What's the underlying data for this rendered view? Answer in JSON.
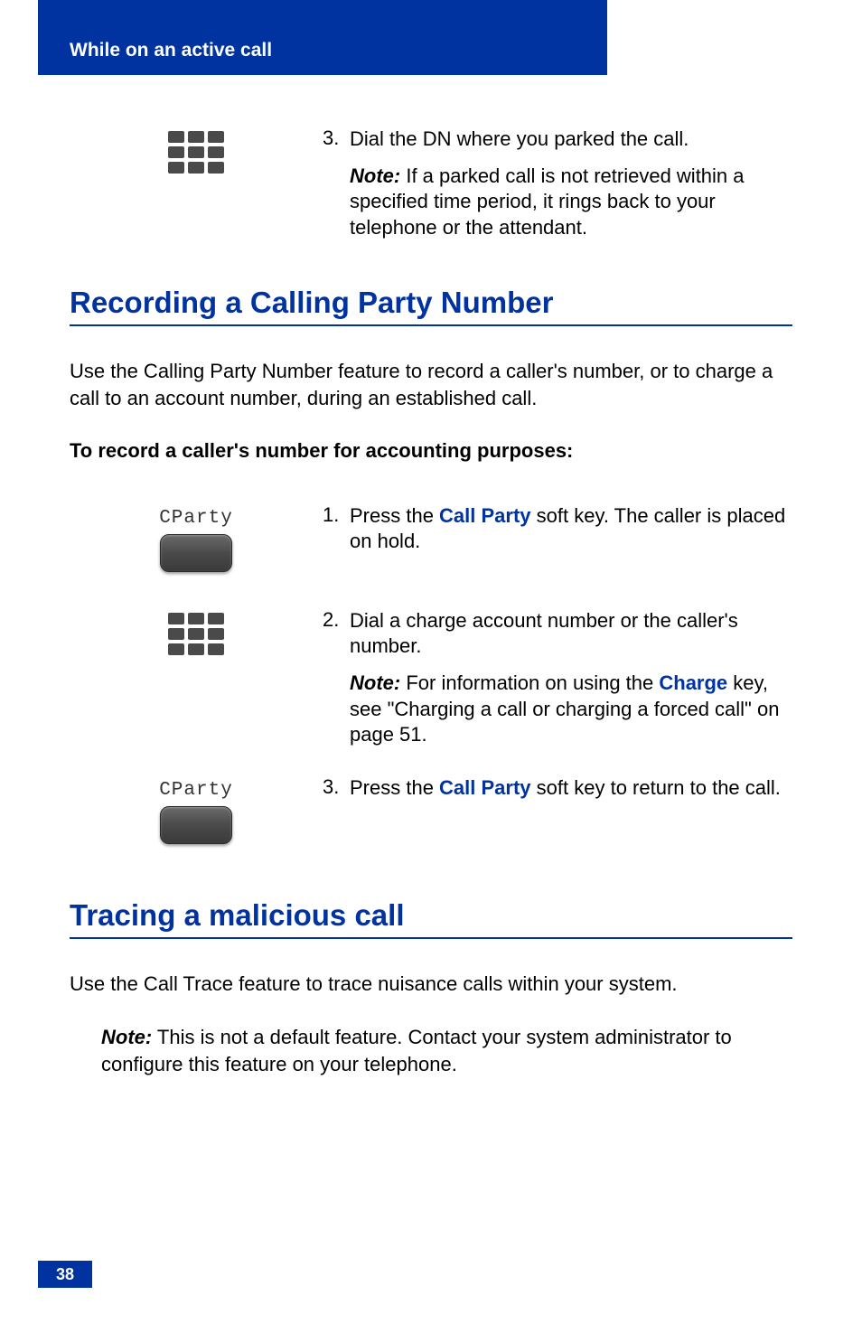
{
  "header": {
    "section_title": "While on an active call"
  },
  "step_dial_parked": {
    "number": "3.",
    "text": "Dial the DN where you parked the call.",
    "note_label": "Note:",
    "note_text": " If a parked call is not retrieved within a specified time period, it rings back to your telephone or the attendant."
  },
  "heading_recording": "Recording a Calling Party Number",
  "recording_intro": "Use the Calling Party Number feature to record a caller's number, or to charge a call to an account number, during an established call.",
  "recording_procedure_title": "To record a caller's number for accounting purposes:",
  "softkey_cparty": "CParty",
  "recording_steps": {
    "step1": {
      "number": "1.",
      "text_before": "Press the ",
      "link": "Call Party",
      "text_after": " soft key. The caller is placed on hold."
    },
    "step2": {
      "number": "2.",
      "text": "Dial a charge account number or the caller's number.",
      "note_label": "Note:",
      "note_before": " For information on using the ",
      "link": "Charge",
      "note_after": " key, see \"Charging a call or charging a forced call\" on page 51."
    },
    "step3": {
      "number": "3.",
      "text_before": "Press the ",
      "link": "Call Party",
      "text_after": " soft key to return to the call."
    }
  },
  "heading_tracing": "Tracing a malicious call",
  "tracing_intro": "Use the Call Trace feature to trace nuisance calls within your system.",
  "tracing_note": {
    "label": "Note:",
    "text": "  This is not a default feature. Contact your system administrator to configure this feature on your telephone."
  },
  "page_number": "38"
}
